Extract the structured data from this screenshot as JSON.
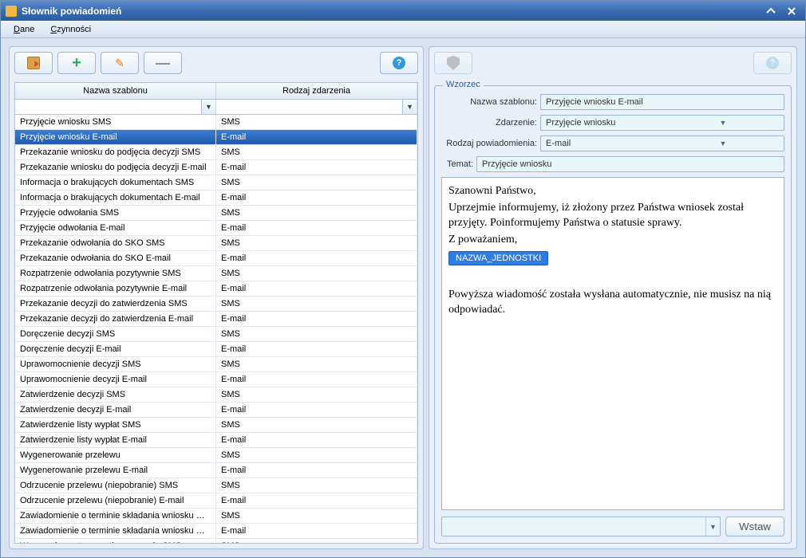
{
  "window": {
    "title": "Słownik powiadomień"
  },
  "menu": {
    "dane": "Dane",
    "czynnosci": "Czynności"
  },
  "table": {
    "headers": {
      "name": "Nazwa szablonu",
      "event": "Rodzaj zdarzenia"
    },
    "rows": [
      {
        "name": "Przyjęcie wniosku SMS",
        "event": "SMS"
      },
      {
        "name": "Przyjęcie wniosku E-mail",
        "event": "E-mail"
      },
      {
        "name": "Przekazanie wniosku do podjęcia decyzji SMS",
        "event": "SMS"
      },
      {
        "name": "Przekazanie wniosku do podjęcia decyzji E-mail",
        "event": "E-mail"
      },
      {
        "name": "Informacja o brakujących dokumentach SMS",
        "event": "SMS"
      },
      {
        "name": "Informacja o brakujących dokumentach E-mail",
        "event": "E-mail"
      },
      {
        "name": "Przyjęcie odwołania SMS",
        "event": "SMS"
      },
      {
        "name": "Przyjęcie odwołania E-mail",
        "event": "E-mail"
      },
      {
        "name": "Przekazanie odwołania do SKO SMS",
        "event": "SMS"
      },
      {
        "name": "Przekazanie odwołania do SKO E-mail",
        "event": "E-mail"
      },
      {
        "name": "Rozpatrzenie odwołania pozytywnie SMS",
        "event": "SMS"
      },
      {
        "name": "Rozpatrzenie odwołania pozytywnie E-mail",
        "event": "E-mail"
      },
      {
        "name": "Przekazanie decyzji do zatwierdzenia SMS",
        "event": "SMS"
      },
      {
        "name": "Przekazanie decyzji do zatwierdzenia E-mail",
        "event": "E-mail"
      },
      {
        "name": "Doręczenie decyzji SMS",
        "event": "SMS"
      },
      {
        "name": "Doręczenie decyzji E-mail",
        "event": "E-mail"
      },
      {
        "name": "Uprawomocnienie decyzji SMS",
        "event": "SMS"
      },
      {
        "name": "Uprawomocnienie decyzji E-mail",
        "event": "E-mail"
      },
      {
        "name": "Zatwierdzenie decyzji SMS",
        "event": "SMS"
      },
      {
        "name": "Zatwierdzenie decyzji E-mail",
        "event": "E-mail"
      },
      {
        "name": "Zatwierdzenie listy wypłat SMS",
        "event": "SMS"
      },
      {
        "name": "Zatwierdzenie listy wypłat E-mail",
        "event": "E-mail"
      },
      {
        "name": "Wygenerowanie przelewu",
        "event": "SMS"
      },
      {
        "name": "Wygenerowanie przelewu E-mail",
        "event": "E-mail"
      },
      {
        "name": "Odrzucenie przelewu (niepobranie) SMS",
        "event": "SMS"
      },
      {
        "name": "Odrzucenie przelewu (niepobranie) E-mail",
        "event": "E-mail"
      },
      {
        "name": "Zawiadomienie o terminie składania wniosku SMS",
        "event": "SMS"
      },
      {
        "name": "Zawiadomienie o terminie składania wniosku E-...",
        "event": "E-mail"
      },
      {
        "name": "Wszczęcie postępowania w sprawie SMS",
        "event": "SMS"
      }
    ],
    "selected_index": 1
  },
  "pattern": {
    "legend": "Wzorzec",
    "labels": {
      "template_name": "Nazwa szablonu:",
      "event": "Zdarzenie:",
      "notification_type": "Rodzaj powiadomienia:",
      "subject": "Temat:"
    },
    "values": {
      "template_name": "Przyjęcie wniosku E-mail",
      "event": "Przyjęcie wniosku",
      "notification_type": "E-mail",
      "subject": "Przyjęcie wniosku"
    },
    "body": {
      "line1": "Szanowni Państwo,",
      "line2": "Uprzejmie informujemy, iż złożony przez Państwa wniosek został przyjęty. Poinformujemy Państwa o statusie sprawy.",
      "line3": "Z poważaniem,",
      "chip": "NAZWA_JEDNOSTKI",
      "line4": "Powyższa wiadomość została wysłana automatycznie, nie musisz na nią odpowiadać."
    },
    "insert_label": "Wstaw"
  }
}
